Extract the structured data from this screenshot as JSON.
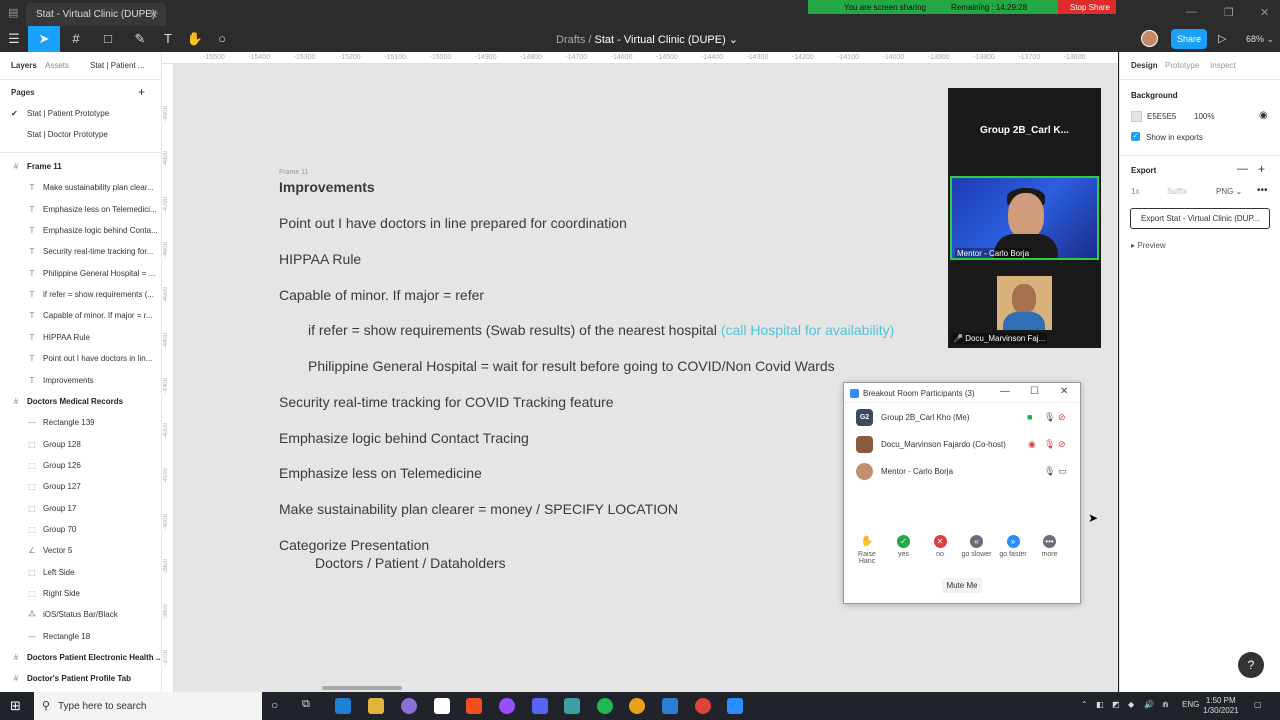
{
  "browser": {
    "tab_title": "Stat - Virtual Clinic (DUPE)",
    "close_glyph": "✕",
    "new_tab_glyph": "+"
  },
  "screen_share": {
    "status": "You are screen sharing",
    "remaining": "Remaining : 14:29:28",
    "stop_label": "Stop Share"
  },
  "toolbar": {
    "breadcrumb_parent": "Drafts",
    "breadcrumb_sep": "/",
    "file_name": "Stat - Virtual Clinic (DUPE) ⌄",
    "share_label": "Share",
    "zoom": "68% ⌄",
    "accent": "#18a0fb"
  },
  "left_panel": {
    "tabs": [
      "Layers",
      "Assets",
      "Stat | Patient ..."
    ],
    "pages_title": "Pages",
    "pages": [
      {
        "label": "Stat | Patient Prototype",
        "current": "✔"
      },
      {
        "label": "Stat | Doctor Prototype",
        "current": ""
      }
    ],
    "layers": [
      {
        "label": "Frame 11",
        "type": "frame"
      },
      {
        "label": "Make sustainability plan clear...",
        "type": "text"
      },
      {
        "label": "Emphasize less on Telemedici...",
        "type": "text"
      },
      {
        "label": "Emphasize logic behind Conta...",
        "type": "text"
      },
      {
        "label": "Security real-time tracking for...",
        "type": "text"
      },
      {
        "label": "Philippine General Hospital = ...",
        "type": "text"
      },
      {
        "label": "if refer = show requirements (...",
        "type": "text"
      },
      {
        "label": "Capable of minor. If major = r...",
        "type": "text"
      },
      {
        "label": "HIPPAA Rule",
        "type": "text"
      },
      {
        "label": "Point out I have doctors in lin...",
        "type": "text"
      },
      {
        "label": "Improvements",
        "type": "text"
      },
      {
        "label": "Doctors Medical Records",
        "type": "frame"
      },
      {
        "label": "Rectangle 139",
        "type": "line"
      },
      {
        "label": "Group 128",
        "type": "group"
      },
      {
        "label": "Group 126",
        "type": "group"
      },
      {
        "label": "Group 127",
        "type": "group"
      },
      {
        "label": "Group 17",
        "type": "group"
      },
      {
        "label": "Group 70",
        "type": "group"
      },
      {
        "label": "Vector 5",
        "type": "vector"
      },
      {
        "label": "Left Side",
        "type": "group"
      },
      {
        "label": "Right Side",
        "type": "group"
      },
      {
        "label": "iOS/Status Bar/Black",
        "type": "component"
      },
      {
        "label": "Rectangle 18",
        "type": "line"
      },
      {
        "label": "Doctors Patient Electronic Health ...",
        "type": "frame"
      },
      {
        "label": "Doctor's Patient Profile Tab",
        "type": "frame"
      }
    ]
  },
  "canvas": {
    "ruler_top": [
      "-15500",
      "-15400",
      "-15300",
      "-15200",
      "-15100",
      "-15000",
      "-14900",
      "-14800",
      "-14700",
      "-14600",
      "-14500",
      "-14400",
      "-14300",
      "-14200",
      "-14100",
      "-14000",
      "-13900",
      "-13800",
      "-13700",
      "-13600"
    ],
    "ruler_left": [
      "-4900",
      "-4800",
      "-4700",
      "-4600",
      "-4500",
      "-4400",
      "-4300",
      "-4200",
      "-4100",
      "-4000",
      "-3900",
      "-3800",
      "-3700"
    ],
    "frame_label": "Frame 11",
    "heading": "Improvements",
    "notes": [
      "Point out I have doctors in line prepared for coordination",
      "HIPPAA Rule",
      "Capable of minor. If major = refer",
      "if refer = show requirements (Swab results) of the nearest hospital",
      "Philippine General Hospital = wait for result before going to COVID/Non Covid Wards",
      "Security real-time tracking for COVID Tracking feature",
      "Emphasize logic behind Contact Tracing",
      "Emphasize less on Telemedicine",
      "Make sustainability plan clearer = money / SPECIFY LOCATION",
      "Categorize Presentation",
      "Doctors / Patient / Dataholders"
    ],
    "highlight": "(call Hospital for availability)",
    "highlight_color": "#4fc3d8"
  },
  "video_panel": {
    "group_name": "Group 2B_Carl K...",
    "speaker_name": "Mentor - Carlo Borja",
    "participant_name": "Docu_Marvinson Faj..."
  },
  "breakout": {
    "title": "Breakout Room Participants (3)",
    "window_controls": [
      "—",
      "☐",
      "✕"
    ],
    "participants": [
      {
        "initials": "G2",
        "name": "Group 2B_Carl Kho (Me)"
      },
      {
        "initials": "",
        "name": "Docu_Marvinson Fajardo (Co-host)"
      },
      {
        "initials": "",
        "name": "Mentor - Carlo Borja"
      }
    ],
    "reactions": [
      {
        "label": "Raise Hanc",
        "glyph": "✋",
        "color": "#ffffff"
      },
      {
        "label": "yes",
        "glyph": "✓",
        "color": "#22a845"
      },
      {
        "label": "no",
        "glyph": "✕",
        "color": "#e03b3b"
      },
      {
        "label": "go slower",
        "glyph": "«",
        "color": "#6b6b7a"
      },
      {
        "label": "go faster",
        "glyph": "»",
        "color": "#2d8cff"
      },
      {
        "label": "more",
        "glyph": "•••",
        "color": "#6b6b7a"
      }
    ],
    "mute_label": "Mute Me"
  },
  "right_panel": {
    "tabs": [
      "Design",
      "Prototype",
      "Inspect"
    ],
    "background_title": "Background",
    "bg_hex": "E5E5E5",
    "bg_opacity": "100%",
    "show_in_exports": "Show in exports",
    "export_title": "Export",
    "export_scale": "1x",
    "export_suffix_placeholder": "Suffix",
    "export_format": "PNG ⌄",
    "export_button": "Export Stat - Virtual Clinic (DUP...",
    "preview": "Preview"
  },
  "taskbar": {
    "search_placeholder": "Type here to search",
    "lang": "ENG",
    "time": "1:50 PM",
    "date": "1/30/2021"
  }
}
